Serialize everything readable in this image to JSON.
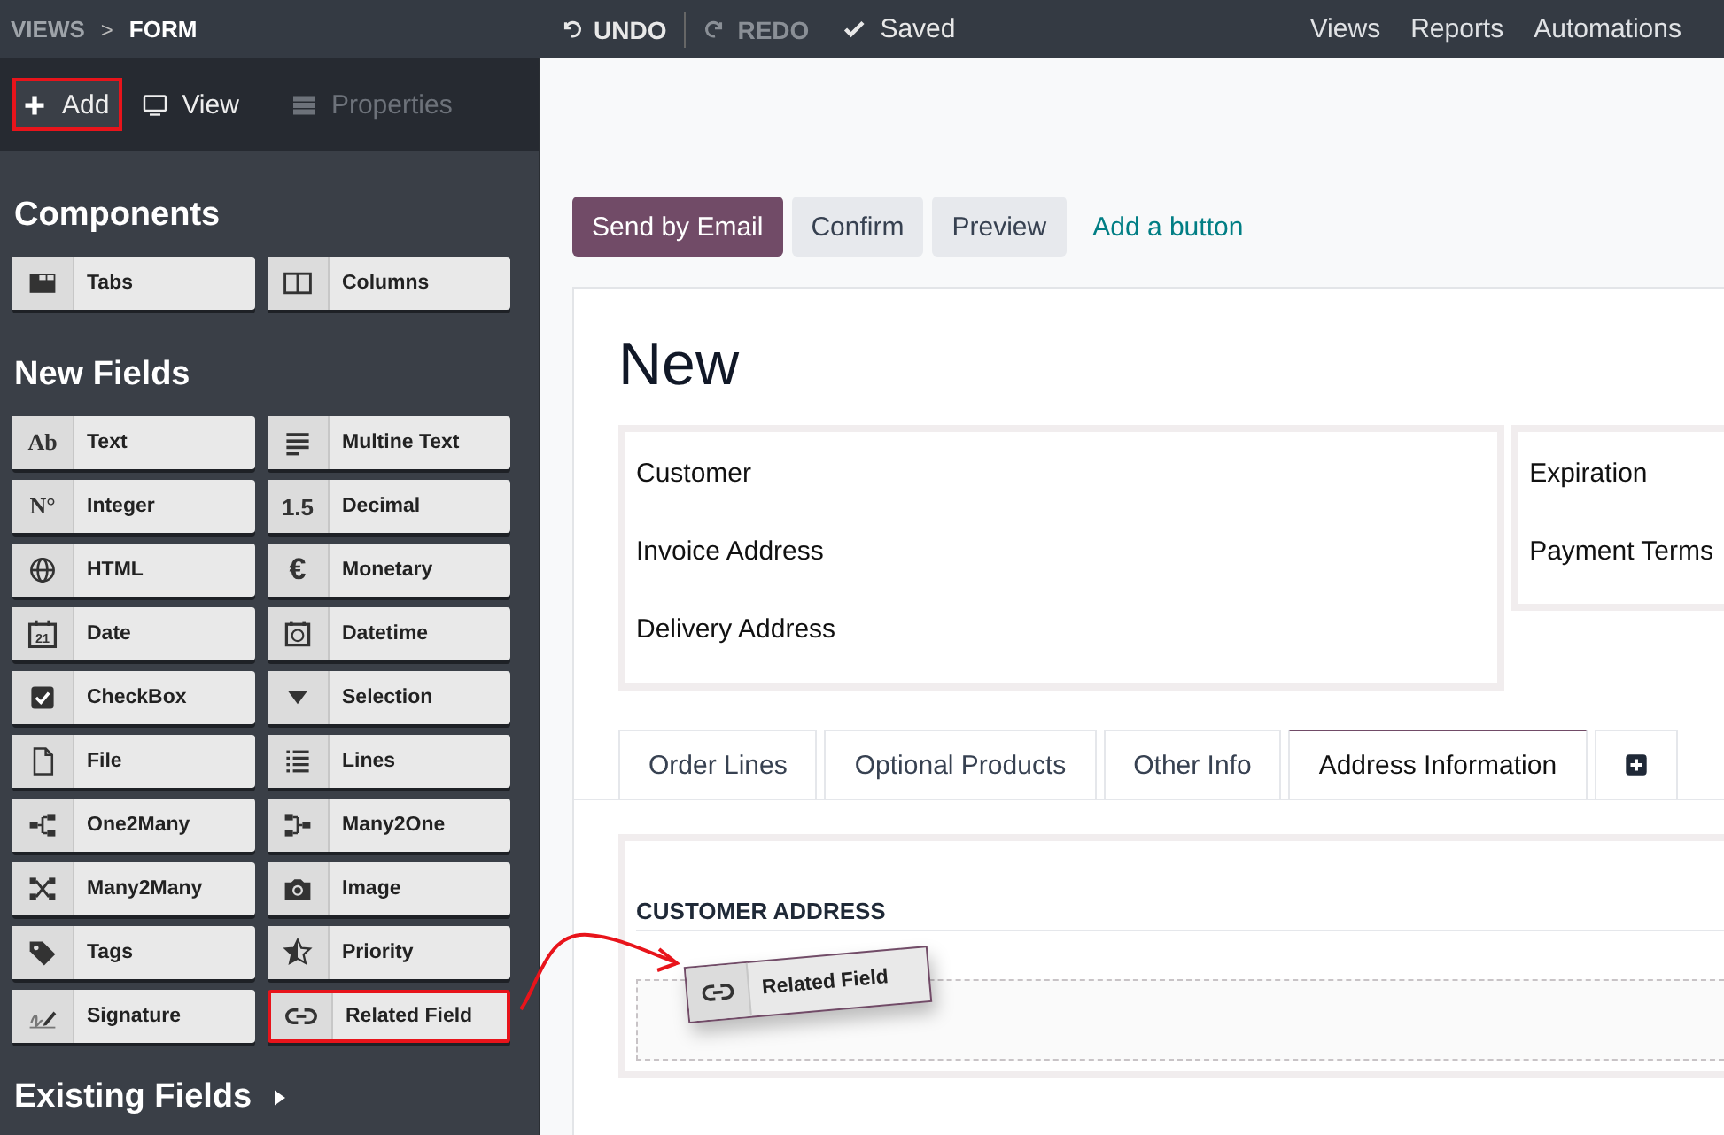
{
  "topbar": {
    "breadcrumb": [
      {
        "label": "VIEWS",
        "current": false
      },
      {
        "label": "FORM",
        "current": true
      }
    ],
    "separator": ">",
    "actions": [
      {
        "label": "UNDO",
        "disabled": false
      },
      {
        "label": "REDO",
        "disabled": true
      }
    ],
    "status": "Saved",
    "menu": [
      "Views",
      "Reports",
      "Automations"
    ]
  },
  "sidebar": {
    "tabs": [
      {
        "label": "Add",
        "selected": true,
        "disabled": false,
        "highlighted": true
      },
      {
        "label": "View",
        "selected": false,
        "disabled": false,
        "highlighted": false
      },
      {
        "label": "Properties",
        "selected": false,
        "disabled": true,
        "highlighted": false
      }
    ],
    "components": {
      "title": "Components",
      "items": [
        {
          "label": "Tabs",
          "highlighted": false
        },
        {
          "label": "Columns",
          "highlighted": false
        }
      ]
    },
    "new_fields": {
      "title": "New Fields",
      "items": [
        {
          "label": "Text",
          "glyph": "Ab",
          "highlighted": false
        },
        {
          "label": "Multine Text",
          "highlighted": false
        },
        {
          "label": "Integer",
          "glyph": "N°",
          "highlighted": false
        },
        {
          "label": "Decimal",
          "glyph": "1.5",
          "highlighted": false
        },
        {
          "label": "HTML",
          "highlighted": false
        },
        {
          "label": "Monetary",
          "glyph": "€",
          "highlighted": false
        },
        {
          "label": "Date",
          "glyph": "21",
          "highlighted": false
        },
        {
          "label": "Datetime",
          "highlighted": false
        },
        {
          "label": "CheckBox",
          "highlighted": false
        },
        {
          "label": "Selection",
          "highlighted": false
        },
        {
          "label": "File",
          "highlighted": false
        },
        {
          "label": "Lines",
          "highlighted": false
        },
        {
          "label": "One2Many",
          "highlighted": false
        },
        {
          "label": "Many2One",
          "highlighted": false
        },
        {
          "label": "Many2Many",
          "highlighted": false
        },
        {
          "label": "Image",
          "highlighted": false
        },
        {
          "label": "Tags",
          "highlighted": false
        },
        {
          "label": "Priority",
          "highlighted": false
        },
        {
          "label": "Signature",
          "highlighted": false
        },
        {
          "label": "Related Field",
          "highlighted": true
        }
      ]
    },
    "existing_fields": {
      "title": "Existing Fields",
      "expanded": false
    }
  },
  "buttons": [
    {
      "label": "Send by Email",
      "kind": "primary"
    },
    {
      "label": "Confirm",
      "kind": "secondary"
    },
    {
      "label": "Preview",
      "kind": "secondary"
    },
    {
      "label": "Add a button",
      "kind": "link"
    }
  ],
  "form": {
    "title": "New",
    "left_fields": [
      "Customer",
      "Invoice Address",
      "Delivery Address"
    ],
    "right_fields": [
      "Expiration",
      "Payment Terms"
    ],
    "tabs": [
      {
        "label": "Order Lines",
        "selected": false
      },
      {
        "label": "Optional Products",
        "selected": false
      },
      {
        "label": "Other Info",
        "selected": false
      },
      {
        "label": "Address Information",
        "selected": true
      }
    ],
    "section_title": "CUSTOMER ADDRESS",
    "dragged_item": {
      "label": "Related Field"
    }
  }
}
